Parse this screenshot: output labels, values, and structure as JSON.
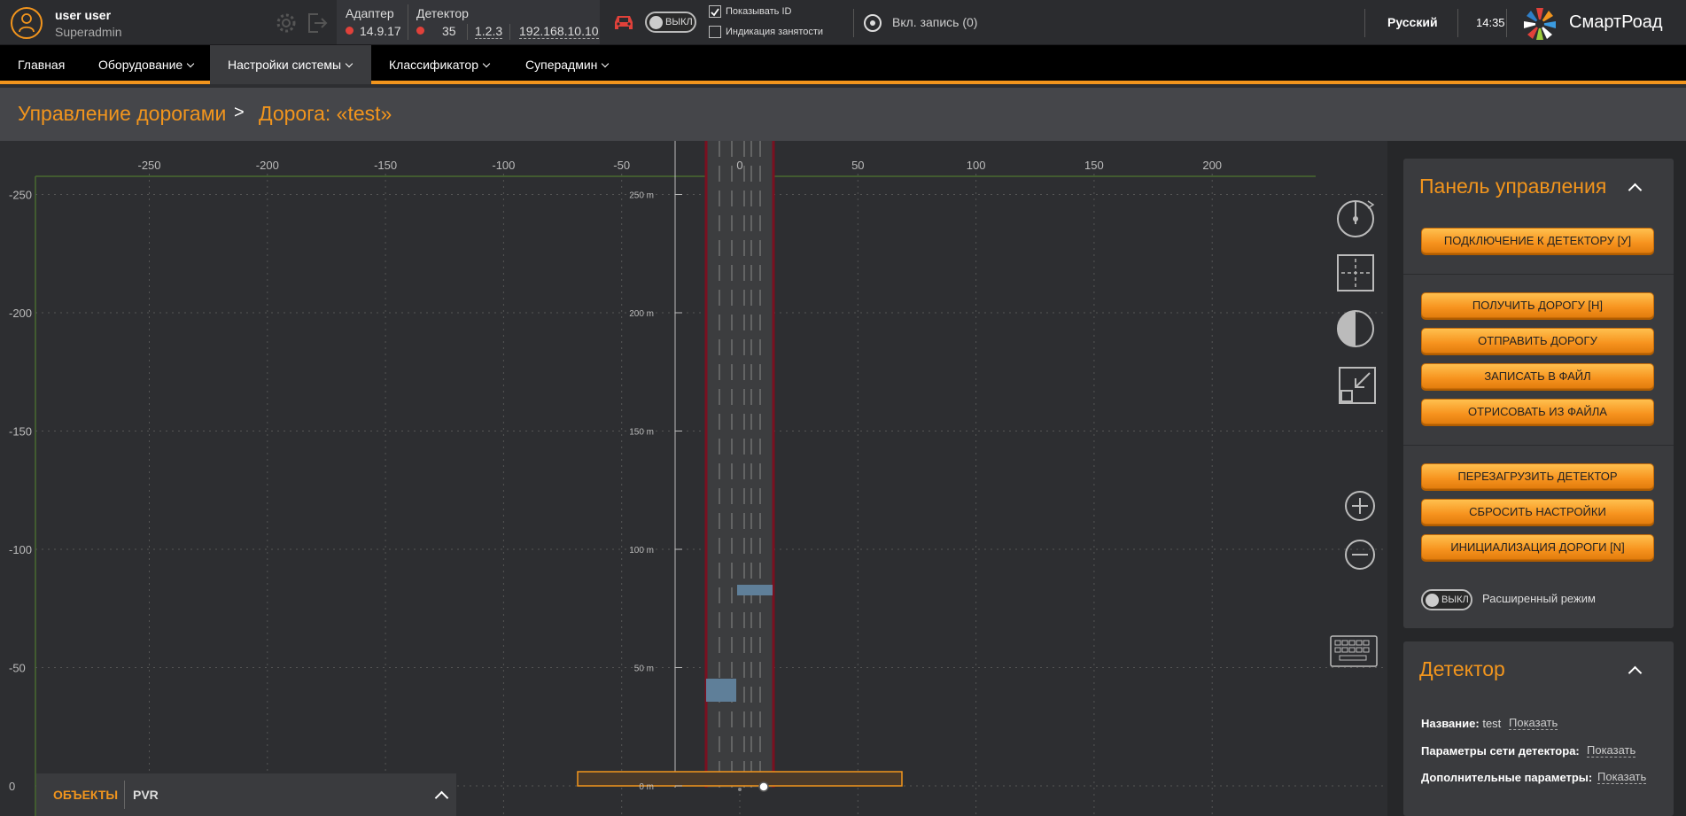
{
  "user": {
    "name": "user user",
    "role": "Superadmin"
  },
  "adapter": {
    "label": "Адаптер",
    "version": "14.9.17"
  },
  "detector": {
    "label": "Детектор",
    "count": "35",
    "version": "1.2.3",
    "ip": "192.168.10.10"
  },
  "toggle_main": {
    "label": "ВЫКЛ"
  },
  "checkboxes": {
    "show_id": "Показывать ID",
    "busy": "Индикация занятости"
  },
  "recording": {
    "label": "Вкл. запись (0)"
  },
  "language": "Русский",
  "time": "14:35",
  "brand": "СмартРоад",
  "nav": [
    {
      "label": "Главная"
    },
    {
      "label": "Оборудование"
    },
    {
      "label": "Настройки системы"
    },
    {
      "label": "Классификатор"
    },
    {
      "label": "Суперадмин"
    }
  ],
  "breadcrumb": {
    "root": "Управление дорогами",
    "sep": ">",
    "current": "Дорога: «test»"
  },
  "chart_data": {
    "type": "grid",
    "x_ticks": [
      "-250",
      "-200",
      "-150",
      "-100",
      "-50",
      "0",
      "50",
      "100",
      "150",
      "200"
    ],
    "y_ticks": [
      "-250",
      "-200",
      "-150",
      "-100",
      "-50",
      "0"
    ],
    "road_ticks": [
      "250 m",
      "200 m",
      "150 m",
      "100 m",
      "50 m",
      "0 m"
    ]
  },
  "control_panel": {
    "title": "Панель управления",
    "buttons_top": [
      "ПОДКЛЮЧЕНИЕ К ДЕТЕКТОРУ [У]"
    ],
    "buttons_mid": [
      "ПОЛУЧИТЬ ДОРОГУ [H]",
      "ОТПРАВИТЬ ДОРОГУ",
      "ЗАПИСАТЬ В ФАЙЛ",
      "ОТРИСОВАТЬ ИЗ ФАЙЛА"
    ],
    "buttons_bot": [
      "ПЕРЕЗАГРУЗИТЬ ДЕТЕКТОР",
      "СБРОСИТЬ НАСТРОЙКИ",
      "ИНИЦИАЛИЗАЦИЯ ДОРОГИ [N]"
    ],
    "ext_toggle": "ВЫКЛ",
    "ext_label": "Расширенный режим"
  },
  "detector_card": {
    "title": "Детектор",
    "name_label": "Название:",
    "name_value": "test",
    "name_link": "Показать",
    "net_label": "Параметры сети детектора:",
    "net_link": "Показать",
    "extra_label": "Дополнительные параметры:",
    "extra_link": "Показать"
  },
  "objects_tab": {
    "tab1": "ОБЪЕКТЫ",
    "tab2": "PVR"
  }
}
